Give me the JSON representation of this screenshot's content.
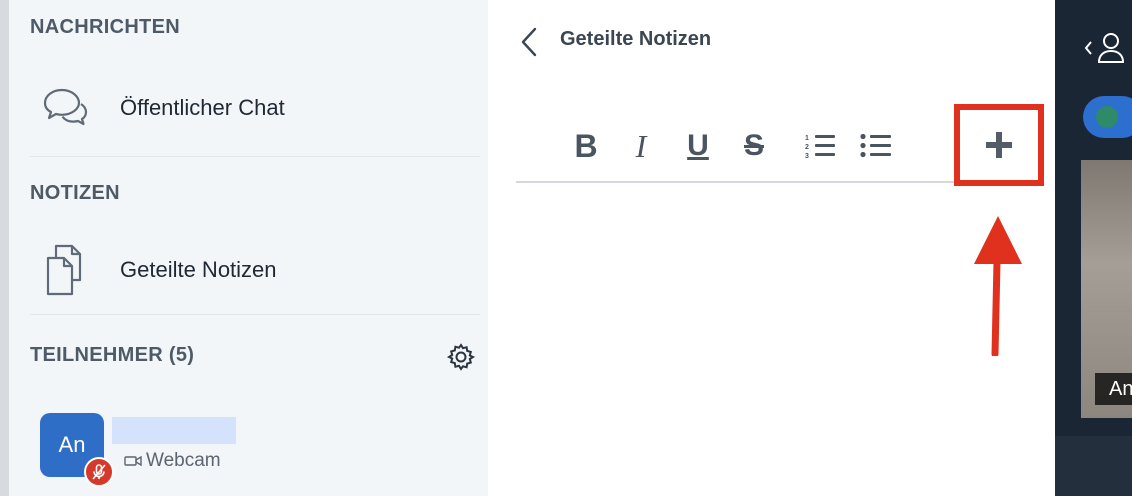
{
  "sidebar": {
    "sections": {
      "messages": "NACHRICHTEN",
      "notes": "NOTIZEN",
      "participants": "TEILNEHMER (5)"
    },
    "items": {
      "public_chat": "Öffentlicher Chat",
      "shared_notes": "Geteilte Notizen"
    },
    "user": {
      "initials": "An",
      "status": "Webcam"
    }
  },
  "notes_panel": {
    "title": "Geteilte Notizen",
    "toolbar": {
      "bold": "B",
      "italic": "I",
      "underline": "U",
      "strike": "S"
    }
  },
  "right_panel": {
    "tile_label": "An"
  },
  "colors": {
    "accent_red": "#e0301e",
    "avatar_blue": "#2e6ec7",
    "mute_red": "#d4392b",
    "dark_panel": "#1a2634"
  },
  "icons": [
    "chat-icon",
    "notes-icon",
    "gear-icon",
    "microphone-muted-icon",
    "webcam-icon",
    "back-chevron-icon",
    "ordered-list-icon",
    "unordered-list-icon",
    "plus-icon",
    "user-icon",
    "arrow-up-icon"
  ]
}
